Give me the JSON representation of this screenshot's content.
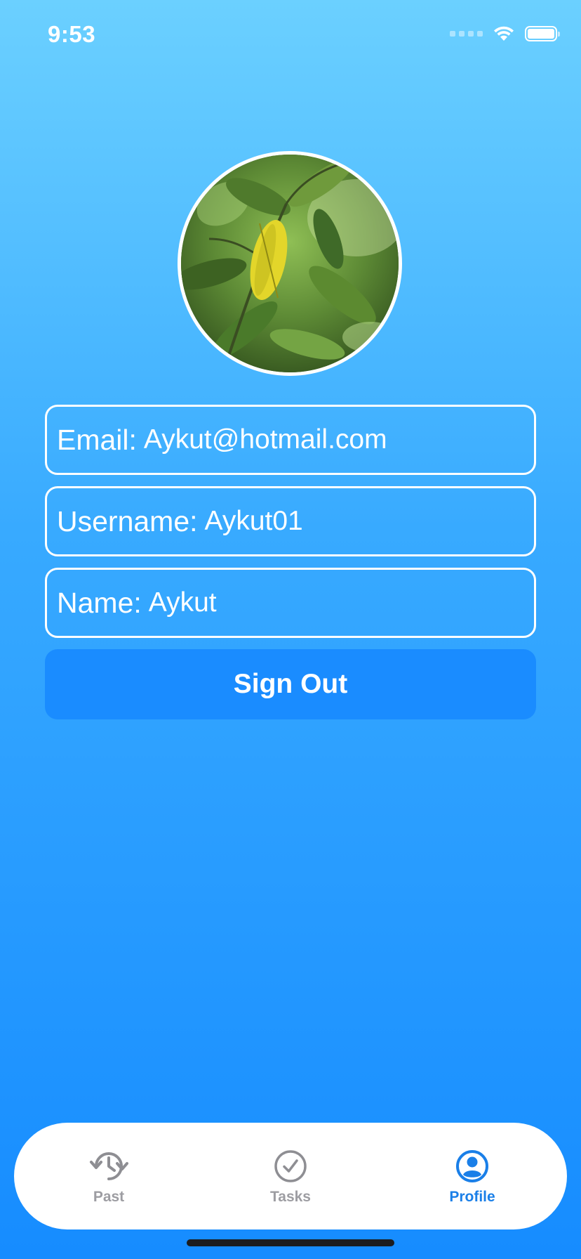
{
  "status_bar": {
    "time": "9:53"
  },
  "profile": {
    "email_label": "Email:",
    "email_value": "Aykut@hotmail.com",
    "username_label": "Username:",
    "username_value": "Aykut01",
    "name_label": "Name:",
    "name_value": "Aykut",
    "sign_out_label": "Sign Out"
  },
  "tab_bar": {
    "tabs": [
      {
        "label": "Past",
        "icon": "clock-history-icon",
        "selected": false
      },
      {
        "label": "Tasks",
        "icon": "checkmark-circle-icon",
        "selected": false
      },
      {
        "label": "Profile",
        "icon": "person-circle-icon",
        "selected": true
      }
    ]
  },
  "colors": {
    "background_top": "#6bd0ff",
    "background_bottom": "#168cff",
    "button": "#1a8cff",
    "tab_active": "#1a7fe8",
    "tab_inactive": "#9d9da2"
  }
}
